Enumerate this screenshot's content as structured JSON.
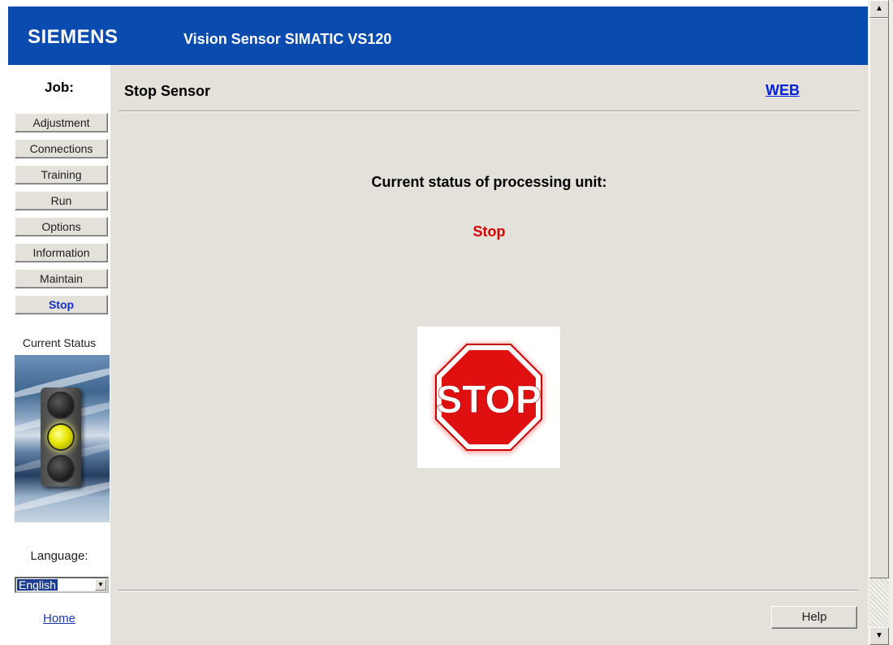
{
  "header": {
    "brand": "SIEMENS",
    "product": "Vision Sensor SIMATIC VS120",
    "brand_color": "#0a4bb0"
  },
  "sidebar": {
    "job_label": "Job:",
    "items": [
      {
        "label": "Adjustment",
        "active": false
      },
      {
        "label": "Connections",
        "active": false
      },
      {
        "label": "Training",
        "active": false
      },
      {
        "label": "Run",
        "active": false
      },
      {
        "label": "Options",
        "active": false
      },
      {
        "label": "Information",
        "active": false
      },
      {
        "label": "Maintain",
        "active": false
      },
      {
        "label": "Stop",
        "active": true
      }
    ],
    "current_status_label": "Current Status",
    "traffic_light": {
      "red": "off",
      "yellow": "on",
      "green": "off",
      "icon": "traffic-light-icon"
    },
    "language_label": "Language:",
    "language_selected": "English",
    "home_link": "Home"
  },
  "main": {
    "title": "Stop Sensor",
    "web_link": "WEB",
    "status_heading": "Current status of processing unit:",
    "status_value": "Stop",
    "status_color": "#d80000",
    "stop_sign_text": "STOP",
    "help_button": "Help"
  },
  "scrollbar": {
    "up_icon": "scroll-up-arrow-icon",
    "down_icon": "scroll-down-arrow-icon"
  }
}
